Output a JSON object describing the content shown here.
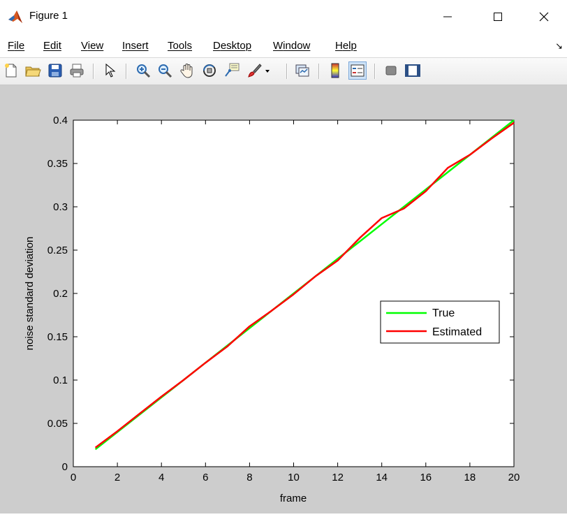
{
  "window": {
    "title": "Figure 1"
  },
  "menu": [
    {
      "key": "F",
      "rest": "ile"
    },
    {
      "key": "E",
      "rest": "dit"
    },
    {
      "key": "V",
      "rest": "iew"
    },
    {
      "key": "I",
      "rest": "nsert"
    },
    {
      "key": "T",
      "rest": "ools"
    },
    {
      "key": "D",
      "rest": "esktop"
    },
    {
      "key": "W",
      "rest": "indow"
    },
    {
      "key": "H",
      "rest": "elp"
    }
  ],
  "toolbar": {
    "icons": [
      "new-figure-icon",
      "open-file-icon",
      "save-icon",
      "print-icon",
      "edit-plot-icon",
      "zoom-in-icon",
      "zoom-out-icon",
      "pan-icon",
      "rotate-3d-icon",
      "data-cursor-icon",
      "brush-icon",
      "brush-dropdown-icon",
      "link-plot-icon",
      "colorbar-icon",
      "legend-icon",
      "hide-plot-tools-icon",
      "show-plot-tools-icon"
    ]
  },
  "colors": {
    "true_line": "#00ff00",
    "estimated_line": "#ff0000",
    "figure_bg": "#cdcdcd"
  },
  "chart_data": {
    "type": "line",
    "xlabel": "frame",
    "ylabel": "noise standard deviation",
    "xlim": [
      0,
      20
    ],
    "ylim": [
      0,
      0.4
    ],
    "xticks": [
      0,
      2,
      4,
      6,
      8,
      10,
      12,
      14,
      16,
      18,
      20
    ],
    "xtick_labels": [
      "0",
      "2",
      "4",
      "6",
      "8",
      "10",
      "12",
      "14",
      "16",
      "18",
      "20"
    ],
    "yticks": [
      0,
      0.05,
      0.1,
      0.15,
      0.2,
      0.25,
      0.3,
      0.35,
      0.4
    ],
    "ytick_labels": [
      "0",
      "0.05",
      "0.1",
      "0.15",
      "0.2",
      "0.25",
      "0.3",
      "0.35",
      "0.4"
    ],
    "legend_position": "center-right",
    "grid": false,
    "series": [
      {
        "name": "True",
        "color": "#00ff00",
        "x": [
          1,
          2,
          3,
          4,
          5,
          6,
          7,
          8,
          9,
          10,
          11,
          12,
          13,
          14,
          15,
          16,
          17,
          18,
          19,
          20
        ],
        "y": [
          0.02,
          0.04,
          0.06,
          0.08,
          0.1,
          0.12,
          0.14,
          0.16,
          0.18,
          0.2,
          0.22,
          0.24,
          0.26,
          0.28,
          0.3,
          0.32,
          0.34,
          0.36,
          0.38,
          0.4
        ]
      },
      {
        "name": "Estimated",
        "color": "#ff0000",
        "x": [
          1,
          2,
          3,
          4,
          5,
          6,
          7,
          8,
          9,
          10,
          11,
          12,
          13,
          14,
          15,
          16,
          17,
          18,
          19,
          20
        ],
        "y": [
          0.022,
          0.041,
          0.061,
          0.081,
          0.1,
          0.12,
          0.139,
          0.162,
          0.18,
          0.199,
          0.22,
          0.238,
          0.264,
          0.287,
          0.298,
          0.318,
          0.345,
          0.36,
          0.379,
          0.397
        ]
      }
    ]
  }
}
